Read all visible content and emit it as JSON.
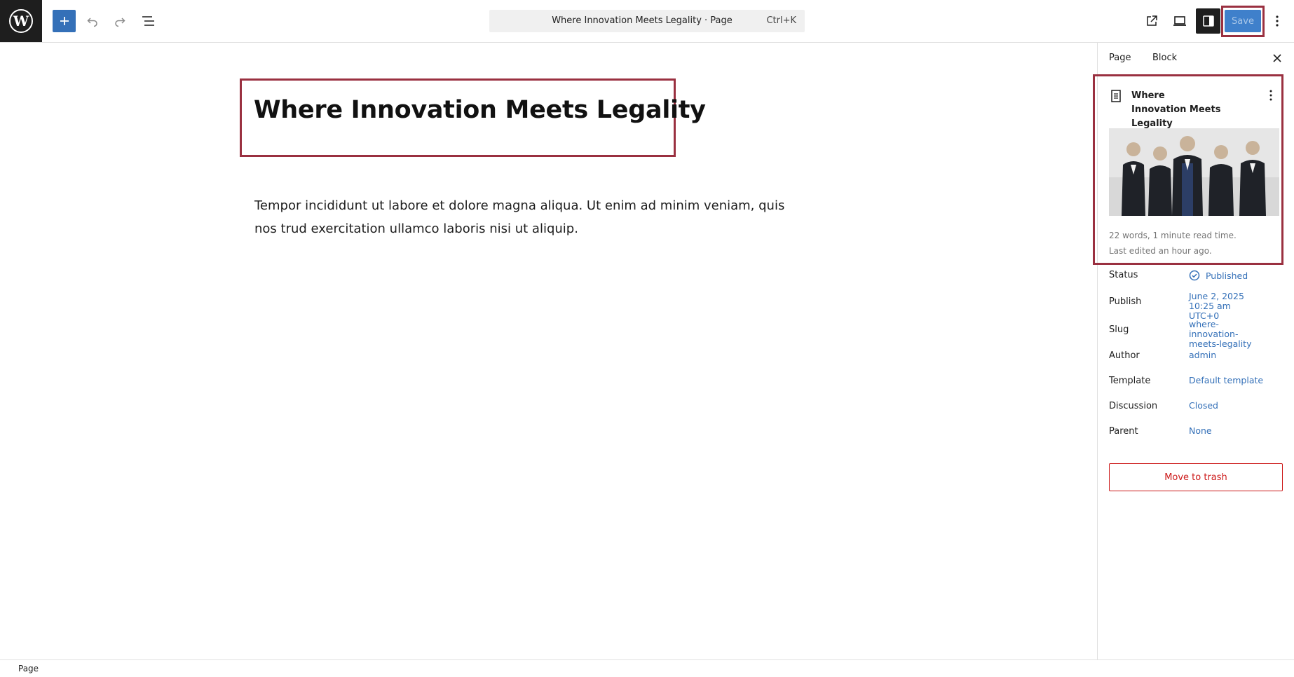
{
  "toolbar": {
    "command_title": "Where Innovation Meets Legality · Page",
    "command_shortcut": "Ctrl+K",
    "save_label": "Save"
  },
  "editor": {
    "title": "Where Innovation Meets Legality",
    "paragraph": "Tempor incididunt ut labore et dolore magna aliqua. Ut enim ad minim veniam, quis nos trud exercitation ullamco laboris nisi ut aliquip."
  },
  "sidebar": {
    "tabs": [
      "Page",
      "Block"
    ],
    "card": {
      "title": "Where Innovation Meets Legality",
      "meta_words": "22 words, 1 minute read time.",
      "meta_edited": "Last edited an hour ago."
    },
    "props": [
      {
        "key": "Status",
        "value": "Published"
      },
      {
        "key": "Publish",
        "value": "June 2, 2025 10:25 am UTC+0"
      },
      {
        "key": "Slug",
        "value": "where-innovation-meets-legality"
      },
      {
        "key": "Author",
        "value": "admin"
      },
      {
        "key": "Template",
        "value": "Default template"
      },
      {
        "key": "Discussion",
        "value": "Closed"
      },
      {
        "key": "Parent",
        "value": "None"
      }
    ],
    "trash_label": "Move to trash"
  },
  "statusbar": {
    "breadcrumb": "Page"
  },
  "colors": {
    "accent": "#3470b8",
    "highlight_outline": "#9a3040",
    "danger": "#cc1818"
  }
}
